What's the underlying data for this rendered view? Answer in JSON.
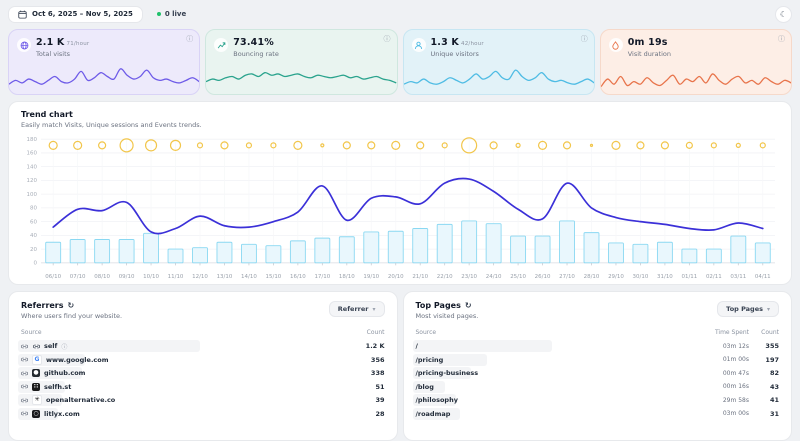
{
  "topbar": {
    "date_range": "Oct 6, 2025 – Nov 5, 2025",
    "live_label": "0 live"
  },
  "stats": [
    {
      "value": "2.1 K",
      "rate": "71/hour",
      "label": "Total visits",
      "accent": "#6e5be8",
      "bg": "#edeafb",
      "border": "#d9d3f6",
      "spark": [
        0.3,
        0.45,
        0.35,
        0.5,
        0.4,
        0.3,
        0.45,
        0.6,
        0.4,
        0.35,
        0.5,
        0.8,
        0.45,
        0.55,
        0.75,
        0.6,
        0.5,
        0.9,
        0.65,
        0.5,
        0.6,
        0.85,
        0.55,
        0.45,
        0.5,
        0.4,
        0.35,
        0.45,
        0.55,
        0.4
      ]
    },
    {
      "value": "73.41%",
      "rate": "",
      "label": "Bouncing rate",
      "accent": "#2aa38d",
      "bg": "#e9f4f0",
      "border": "#cfe7df",
      "spark": [
        0.4,
        0.5,
        0.45,
        0.55,
        0.6,
        0.5,
        0.65,
        0.7,
        0.6,
        0.75,
        0.65,
        0.7,
        0.6,
        0.65,
        0.7,
        0.6,
        0.55,
        0.65,
        0.6,
        0.55,
        0.6,
        0.65,
        0.55,
        0.6,
        0.5,
        0.55,
        0.6,
        0.5,
        0.45,
        0.35
      ]
    },
    {
      "value": "1.3 K",
      "rate": "42/hour",
      "label": "Unique visitors",
      "accent": "#4fbce4",
      "bg": "#e2f2f8",
      "border": "#c7e6f2",
      "spark": [
        0.3,
        0.4,
        0.35,
        0.5,
        0.35,
        0.3,
        0.4,
        0.55,
        0.45,
        0.35,
        0.5,
        0.7,
        0.5,
        0.6,
        0.8,
        0.55,
        0.5,
        0.85,
        0.6,
        0.45,
        0.55,
        0.75,
        0.5,
        0.4,
        0.45,
        0.35,
        0.3,
        0.4,
        0.5,
        0.35
      ]
    },
    {
      "value": "0m 19s",
      "rate": "",
      "label": "Visit duration",
      "accent": "#e8744b",
      "bg": "#fdeee6",
      "border": "#f6d9ca",
      "spark": [
        0.2,
        0.5,
        0.3,
        0.6,
        0.25,
        0.4,
        0.3,
        0.55,
        0.35,
        0.25,
        0.45,
        0.65,
        0.3,
        0.5,
        0.4,
        0.6,
        0.35,
        0.7,
        0.45,
        0.3,
        0.5,
        0.6,
        0.35,
        0.45,
        0.3,
        0.55,
        0.4,
        0.3,
        0.45,
        0.35
      ]
    }
  ],
  "trend": {
    "title": "Trend chart",
    "subtitle": "Easily match Visits, Unique sessions and Events trends.",
    "chart_data": {
      "type": "mixed",
      "x": [
        "06/10",
        "07/10",
        "08/10",
        "09/10",
        "10/10",
        "11/10",
        "12/10",
        "13/10",
        "14/10",
        "15/10",
        "16/10",
        "17/10",
        "18/10",
        "19/10",
        "20/10",
        "21/10",
        "22/10",
        "23/10",
        "24/10",
        "25/10",
        "26/10",
        "27/10",
        "28/10",
        "29/10",
        "30/10",
        "31/10",
        "01/11",
        "02/11",
        "03/11",
        "04/11"
      ],
      "ylim": [
        0,
        180
      ],
      "yticks": [
        0,
        20,
        40,
        60,
        80,
        100,
        120,
        140,
        160,
        180
      ],
      "grid": true,
      "series": [
        {
          "name": "Visits",
          "type": "line",
          "color": "#3b30d8",
          "values": [
            52,
            78,
            76,
            88,
            45,
            50,
            68,
            54,
            52,
            60,
            74,
            112,
            62,
            94,
            96,
            86,
            116,
            122,
            104,
            78,
            64,
            116,
            80,
            66,
            60,
            56,
            50,
            48,
            58,
            50
          ]
        },
        {
          "name": "Unique sessions",
          "type": "bar",
          "color": "#8ad8f2",
          "fill": "#e9f7fd",
          "values": [
            30,
            34,
            34,
            34,
            43,
            20,
            22,
            30,
            27,
            25,
            32,
            36,
            38,
            45,
            46,
            50,
            56,
            61,
            57,
            39,
            39,
            61,
            44,
            29,
            27,
            30,
            20,
            20,
            39,
            29
          ]
        },
        {
          "name": "Events",
          "type": "bubble",
          "color": "#f2c64b",
          "level": 171,
          "sizes": [
            4,
            4,
            3.5,
            6.5,
            5.5,
            5,
            2.5,
            3.5,
            2.5,
            2.5,
            4,
            1.5,
            3.5,
            3.5,
            4,
            3.5,
            2.5,
            7.5,
            3.5,
            2,
            4,
            3.5,
            1,
            4,
            3.5,
            3.5,
            3,
            2.5,
            2,
            2.5
          ]
        }
      ]
    }
  },
  "referrers": {
    "title": "Referrers",
    "subtitle": "Where users find your website.",
    "dropdown": "Referrer",
    "columns": [
      "Source",
      "Count"
    ],
    "rows": [
      {
        "source": "self",
        "count": "1.2 K",
        "info": true,
        "bar": 0.5,
        "icon": {
          "type": "link"
        }
      },
      {
        "source": "www.google.com",
        "count": "356",
        "bar": 0.185,
        "icon": {
          "glyph": "G",
          "fg": "#4285F4",
          "bg": "#ffffff",
          "border": "#e5e7eb"
        }
      },
      {
        "source": "github.com",
        "count": "338",
        "bar": 0.175,
        "icon": {
          "glyph": "●",
          "fg": "#ffffff",
          "bg": "#24292f"
        }
      },
      {
        "source": "selfh.st",
        "count": "51",
        "bar": 0.13,
        "icon": {
          "glyph": "∷",
          "fg": "#ffffff",
          "bg": "#1a1a1a"
        }
      },
      {
        "source": "openalternative.co",
        "count": "39",
        "bar": 0.12,
        "icon": {
          "glyph": "✳",
          "fg": "#111111",
          "bg": "#ffffff",
          "border": "#e5e7eb"
        }
      },
      {
        "source": "litlyx.com",
        "count": "28",
        "bar": 0.11,
        "icon": {
          "glyph": "○",
          "fg": "#ffffff",
          "bg": "#17181c"
        }
      }
    ]
  },
  "top_pages": {
    "title": "Top Pages",
    "subtitle": "Most visited pages.",
    "dropdown": "Top Pages",
    "columns": [
      "Source",
      "Time Spent",
      "Count"
    ],
    "rows": [
      {
        "source": "/",
        "time": "03m 12s",
        "count": "355",
        "bar": 0.385
      },
      {
        "source": "/pricing",
        "time": "01m 00s",
        "count": "197",
        "bar": 0.205
      },
      {
        "source": "/pricing-business",
        "time": "00m 47s",
        "count": "82",
        "bar": 0.16
      },
      {
        "source": "/blog",
        "time": "00m 16s",
        "count": "43",
        "bar": 0.09
      },
      {
        "source": "/philosophy",
        "time": "29m 58s",
        "count": "41",
        "bar": 0.12
      },
      {
        "source": "/roadmap",
        "time": "03m 00s",
        "count": "31",
        "bar": 0.13
      }
    ]
  }
}
